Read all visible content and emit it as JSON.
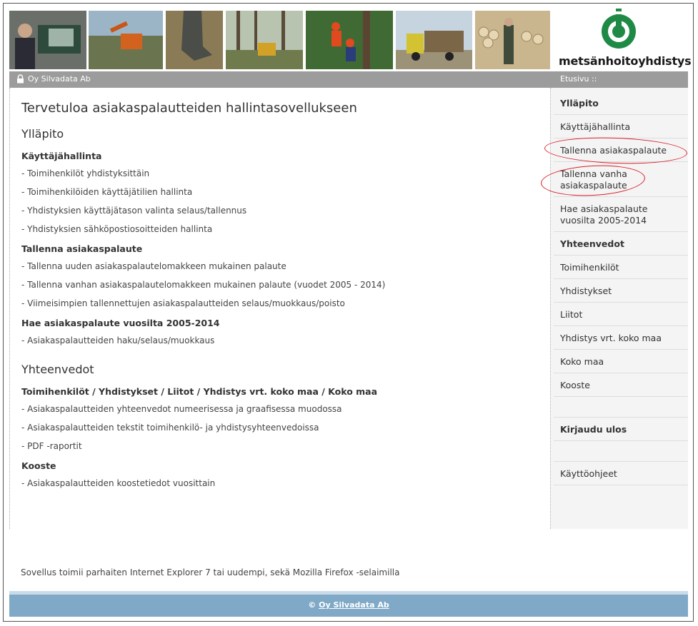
{
  "brand": {
    "logo_text": "metsänhoitoyhdistys",
    "accent": "#1f8a45"
  },
  "topbar": {
    "company": "Oy Silvadata Ab",
    "breadcrumb": "Etusivu ::"
  },
  "main": {
    "title": "Tervetuloa asiakaspalautteiden hallintasovellukseen",
    "sec1": "Ylläpito",
    "g1": {
      "title": "Käyttäjähallinta",
      "items": [
        "- Toimihenkilöt yhdistyksittäin",
        "- Toimihenkilöiden käyttäjätilien hallinta",
        "- Yhdistyksien käyttäjätason valinta selaus/tallennus",
        "- Yhdistyksien sähköpostiosoitteiden hallinta"
      ]
    },
    "g2": {
      "title": "Tallenna asiakaspalaute",
      "items": [
        "- Tallenna uuden asiakaspalautelomakkeen mukainen palaute",
        "- Tallenna vanhan asiakaspalautelomakkeen mukainen palaute (vuodet 2005 - 2014)",
        "- Viimeisimpien tallennettujen asiakaspalautteiden selaus/muokkaus/poisto"
      ]
    },
    "g3": {
      "title": "Hae asiakaspalaute vuosilta 2005-2014",
      "items": [
        "- Asiakaspalautteiden haku/selaus/muokkaus"
      ]
    },
    "sec2": "Yhteenvedot",
    "g4": {
      "title": "Toimihenkilöt / Yhdistykset / Liitot / Yhdistys vrt. koko maa / Koko maa",
      "items": [
        "- Asiakaspalautteiden yhteenvedot numeerisessa ja graafisessa muodossa",
        "- Asiakaspalautteiden tekstit toimihenkilö- ja yhdistysyhteenvedoissa",
        "- PDF -raportit"
      ]
    },
    "g5": {
      "title": "Kooste",
      "items": [
        "- Asiakaspalautteiden koostetiedot vuosittain"
      ]
    }
  },
  "sidebar": {
    "items": [
      "Ylläpito",
      "Käyttäjähallinta",
      "Tallenna asiakaspalaute",
      "Tallenna vanha asiakaspalaute",
      "Hae asiakaspalaute vuosilta 2005-2014",
      "Yhteenvedot",
      "Toimihenkilöt",
      "Yhdistykset",
      "Liitot",
      "Yhdistys vrt. koko maa",
      "Koko maa",
      "Kooste",
      "Kirjaudu ulos",
      "Käyttöohjeet"
    ]
  },
  "note": "Sovellus toimii parhaiten Internet Explorer 7 tai uudempi, sekä Mozilla Firefox -selaimilla",
  "footer": {
    "prefix": "© ",
    "link": "Oy Silvadata Ab"
  }
}
